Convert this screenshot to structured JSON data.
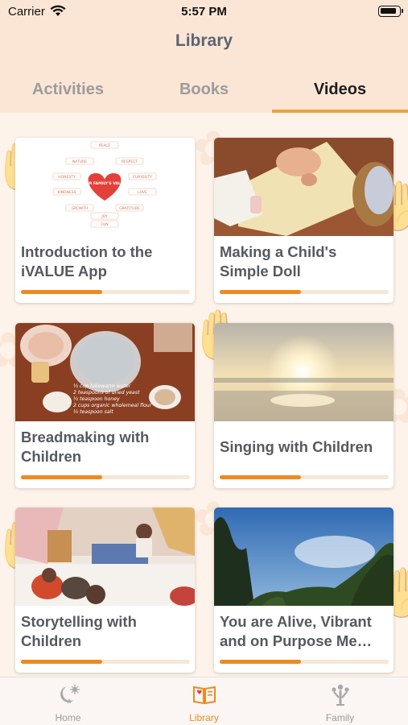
{
  "status_bar": {
    "carrier": "Carrier",
    "time": "5:57 PM"
  },
  "nav": {
    "title": "Library"
  },
  "tabs": [
    {
      "label": "Activities",
      "active": false
    },
    {
      "label": "Books",
      "active": false
    },
    {
      "label": "Videos",
      "active": true
    }
  ],
  "videos": [
    {
      "title": "Introduction to the iVALUE App",
      "progress": 0.48,
      "thumb": "values-diagram"
    },
    {
      "title": "Making a Child's Simple Doll",
      "progress": 0.48,
      "thumb": "doll-making"
    },
    {
      "title": "Breadmaking with Children",
      "progress": 0.48,
      "thumb": "breadmaking",
      "thumb_text": [
        "½ cup lukewarm water",
        "2 teaspoons of dried yeast",
        "½ teaspoon honey",
        "2 cups organic wholemeal flour",
        "½ teaspoon salt"
      ]
    },
    {
      "title": "Singing with Children",
      "progress": 0.48,
      "thumb": "sunset-beach"
    },
    {
      "title": "Storytelling with Children",
      "progress": 0.48,
      "thumb": "storytelling"
    },
    {
      "title": "You are Alive, Vibrant and on Purpose Me…",
      "progress": 0.48,
      "thumb": "forest-sky"
    }
  ],
  "thumb_diagram": {
    "center": "YOUR FAMILY'S VALUES",
    "values": [
      "PEACE",
      "NATURE",
      "RESPECT",
      "HONESTY",
      "CURIOSITY",
      "KINDNESS",
      "LOVE",
      "FUN",
      "GROWTH",
      "GRATITUDE",
      "JOY"
    ]
  },
  "tabbar": [
    {
      "label": "Home",
      "icon": "moon-star-icon",
      "active": false
    },
    {
      "label": "Library",
      "icon": "open-book-icon",
      "active": true
    },
    {
      "label": "Family",
      "icon": "family-tree-icon",
      "active": false
    }
  ],
  "colors": {
    "accent": "#ee8a1e",
    "header_bg": "#fbe6d6",
    "page_bg": "#fdf3ea"
  }
}
